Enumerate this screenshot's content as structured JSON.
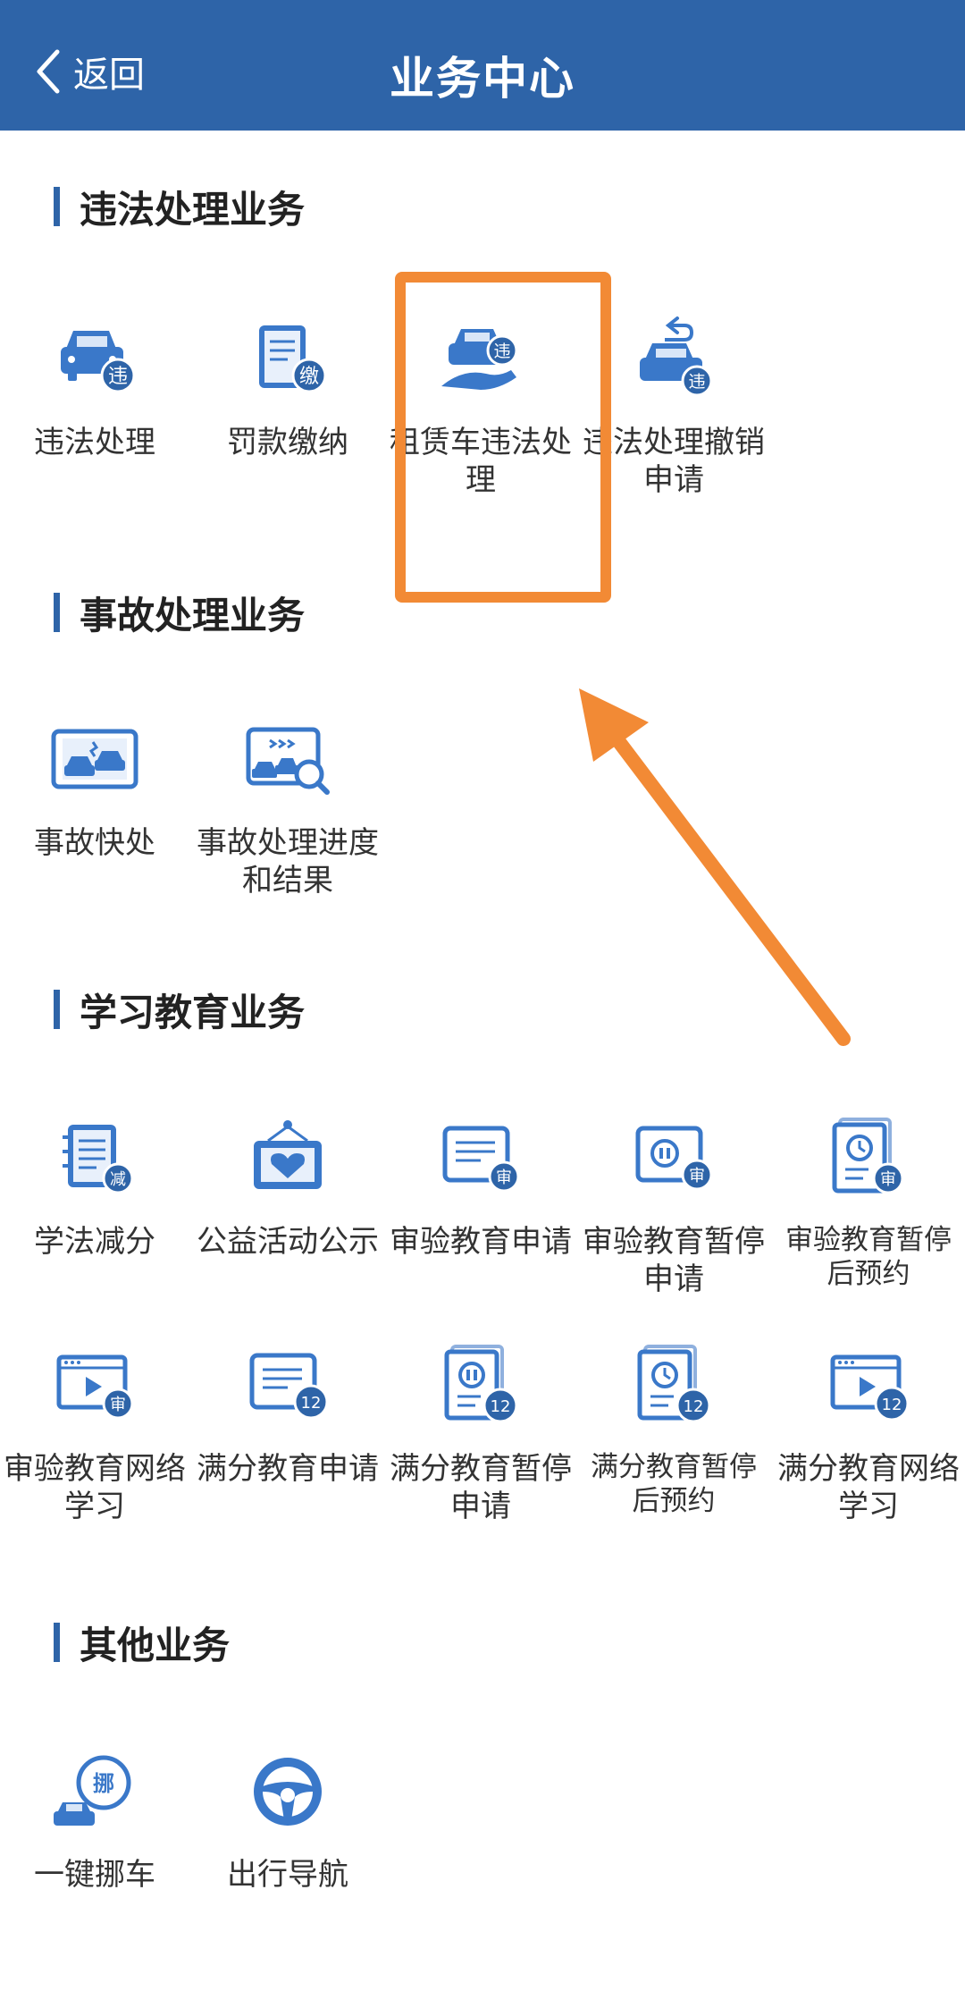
{
  "nav": {
    "back_label": "返回",
    "title": "业务中心"
  },
  "sections": {
    "violation": {
      "title": "违法处理业务",
      "items": [
        "违法处理",
        "罚款缴纳",
        "租赁车违法处理",
        "违法处理撤销申请"
      ]
    },
    "accident": {
      "title": "事故处理业务",
      "items": [
        "事故快处",
        "事故处理进度和结果"
      ]
    },
    "education": {
      "title": "学习教育业务",
      "items": [
        "学法减分",
        "公益活动公示",
        "审验教育申请",
        "审验教育暂停申请",
        "审验教育暂停后预约",
        "审验教育网络学习",
        "满分教育申请",
        "满分教育暂停申请",
        "满分教育暂停后预约",
        "满分教育网络学习"
      ]
    },
    "other": {
      "title": "其他业务",
      "items": [
        "一键挪车",
        "出行导航"
      ]
    }
  },
  "badges": {
    "violation": "违",
    "pay": "缴",
    "reduce": "减",
    "review": "审",
    "full": "12",
    "move": "挪"
  },
  "colors": {
    "brand": "#2e64a8",
    "icon_blue": "#3a78c9",
    "highlight": "#f28a35"
  }
}
